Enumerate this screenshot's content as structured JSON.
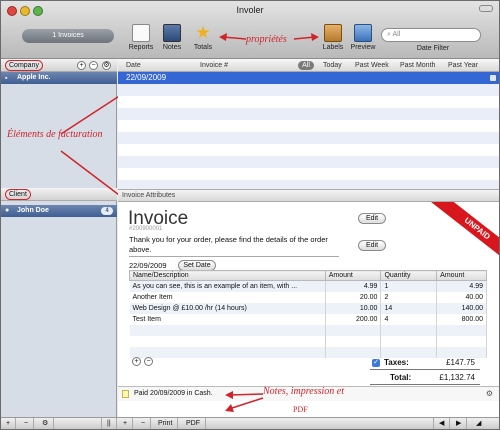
{
  "window": {
    "title": "Involer"
  },
  "toolbar": {
    "invoice_count": "1 Invoices",
    "reports": "Reports",
    "notes": "Notes",
    "totals": "Totals",
    "labels": "Labels",
    "preview": "Preview",
    "search_placeholder": "All",
    "date_filter": "Date Filter"
  },
  "annotations": {
    "proprietes": "propriétés",
    "elements": "Éléments de facturation",
    "notes": "Notes, impression et",
    "pdf": "PDF"
  },
  "company": {
    "header": "Company",
    "items": [
      {
        "name": "Apple Inc."
      }
    ]
  },
  "client": {
    "header": "Client",
    "items": [
      {
        "name": "John Doe",
        "badge": "4"
      }
    ]
  },
  "list": {
    "columns": [
      "Date",
      "Invoice #"
    ],
    "filters": [
      "All",
      "Today",
      "Past Week",
      "Past Month",
      "Past Year"
    ],
    "rows": [
      {
        "date": "22/09/2009"
      }
    ]
  },
  "invoice": {
    "attributes_label": "Invoice Attributes",
    "heading": "Invoice",
    "number": "#200900001",
    "message": "Thank you for your order, please find the details of the order above.",
    "edit_label": "Edit",
    "ribbon": "UNPAID",
    "date": "22/09/2009",
    "set_date_label": "Set Date",
    "table_columns": [
      "Name/Description",
      "Amount",
      "Quantity",
      "Amount"
    ],
    "items": [
      {
        "name": "As you can see, this is an example of an item, with ...",
        "amount": "4.99",
        "qty": "1",
        "total": "4.99"
      },
      {
        "name": "Another Item",
        "amount": "20.00",
        "qty": "2",
        "total": "40.00"
      },
      {
        "name": "Web Design @ £10.00 /hr (14 hours)",
        "amount": "10.00",
        "qty": "14",
        "total": "140.00"
      },
      {
        "name": "Test Item",
        "amount": "200.00",
        "qty": "4",
        "total": "800.00"
      }
    ],
    "taxes_label": "Taxes:",
    "taxes_value": "£147.75",
    "total_label": "Total:",
    "total_value": "£1,132.74",
    "note": "Paid 20/09/2009 in Cash."
  },
  "bottom": {
    "print": "Print",
    "pdf": "PDF"
  }
}
